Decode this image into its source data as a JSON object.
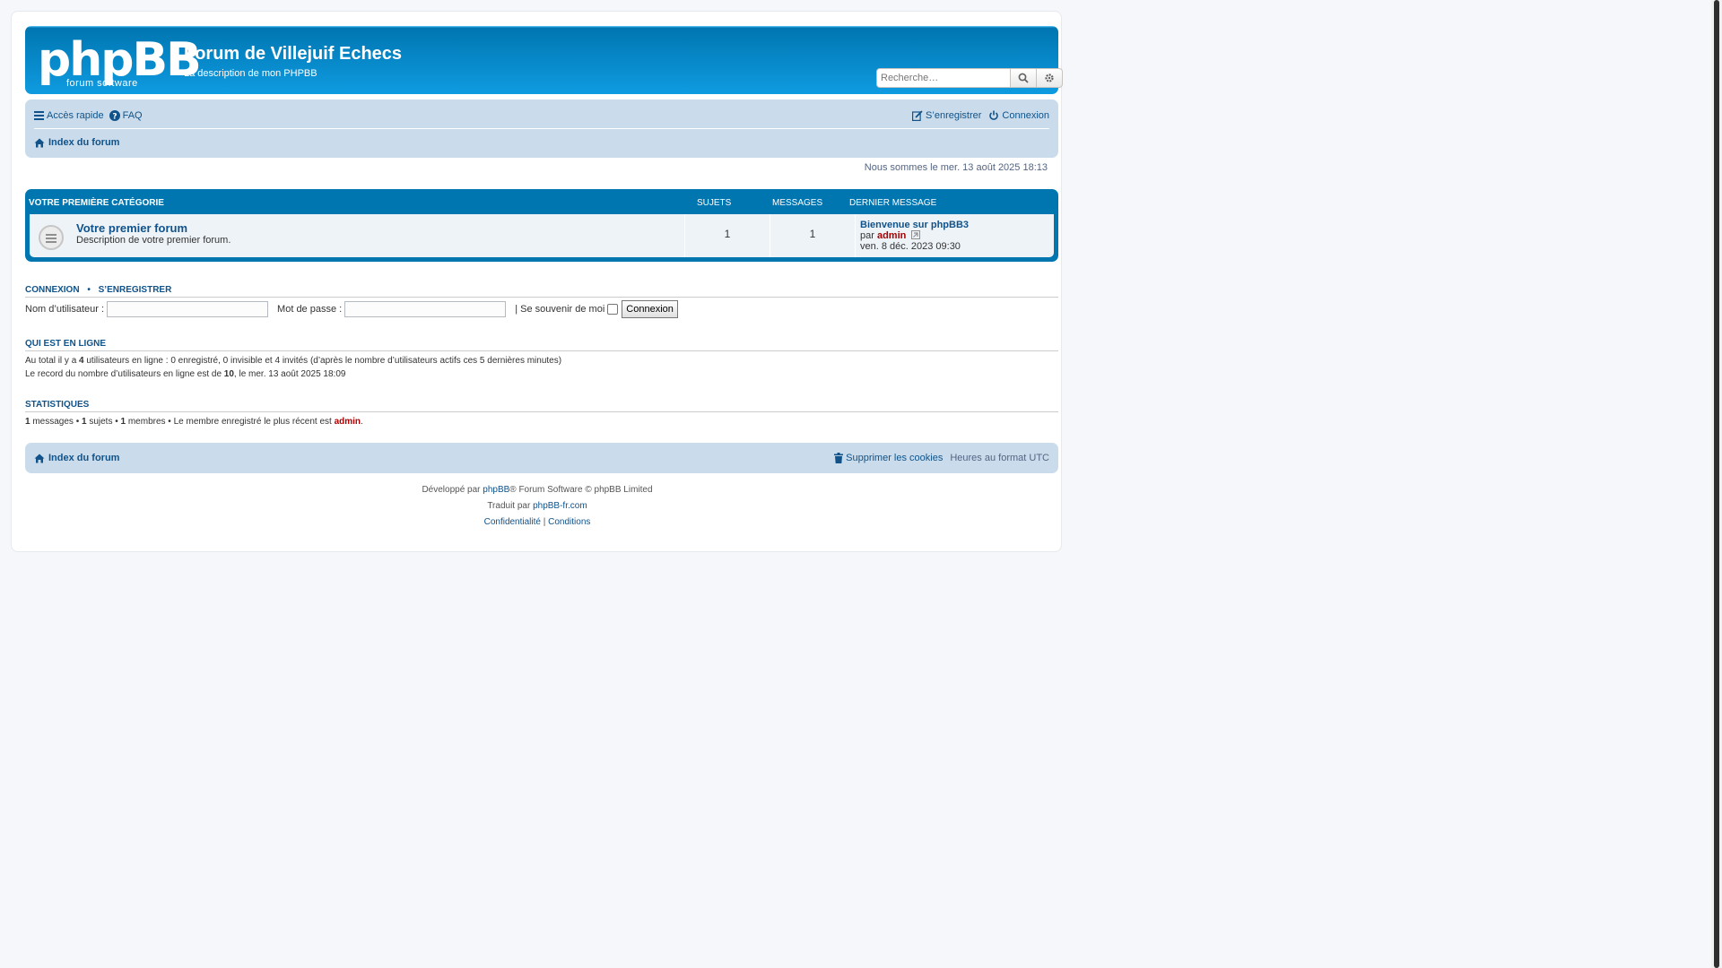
{
  "header": {
    "logo_main": "phpBB",
    "logo_sub": "forum software",
    "site_title": "Forum de Villejuif Echecs",
    "site_description": "La description de mon PHPBB",
    "search_placeholder": "Recherche…"
  },
  "navbar": {
    "quick_access": "Accès rapide",
    "faq": "FAQ",
    "register": "S’enregistrer",
    "login": "Connexion",
    "breadcrumb_index": "Index du forum"
  },
  "datetime": "Nous sommes le mer. 13 août 2025 18:13",
  "category": {
    "title": "Votre première catégorie",
    "col_topics": "Sujets",
    "col_posts": "Messages",
    "col_last": "Dernier message",
    "forum": {
      "name": "Votre premier forum",
      "description": "Description de votre premier forum.",
      "topics": "1",
      "posts": "1",
      "last_post_title": "Bienvenue sur phpBB3",
      "last_post_by": "par",
      "last_post_author": "admin",
      "last_post_date": "ven. 8 déc. 2023 09:30"
    }
  },
  "login_section": {
    "heading_login": "Connexion",
    "bullet": "•",
    "heading_register": "S’enregistrer",
    "username_label": "Nom d’utilisateur :",
    "password_label": "Mot de passe :",
    "remember_label": "| Se souvenir de moi",
    "submit": "Connexion"
  },
  "online": {
    "heading": "Qui est en ligne",
    "l1_a": "Au total il y a ",
    "l1_n": "4",
    "l1_b": " utilisateurs en ligne : 0 enregistré, 0 invisible et 4 invités (d’après le nombre d’utilisateurs actifs ces 5 dernières minutes)",
    "l2_a": "Le record du nombre d’utilisateurs en ligne est de ",
    "l2_n": "10",
    "l2_b": ", le mer. 13 août 2025 18:09"
  },
  "stats": {
    "heading": "Statistiques",
    "posts_n": "1",
    "posts_l": " messages • ",
    "topics_n": "1",
    "topics_l": " sujets • ",
    "members_n": "1",
    "members_l": " membres • Le membre enregistré le plus récent est ",
    "newest": "admin",
    "end": "."
  },
  "footer_nav": {
    "index": "Index du forum",
    "delete_cookies": "Supprimer les cookies",
    "timezone": "Heures au format UTC"
  },
  "footer": {
    "dev_a": "Développé par ",
    "dev_link": "phpBB",
    "dev_b": "® Forum Software © phpBB Limited",
    "tr_a": "Traduit par ",
    "tr_link": "phpBB-fr.com",
    "privacy": "Confidentialité",
    "sep": " | ",
    "terms": "Conditions"
  },
  "colors": {
    "header_blue": "#0076b1",
    "nav_bg": "#cadceb",
    "link": "#105289",
    "admin": "#aa0000"
  }
}
